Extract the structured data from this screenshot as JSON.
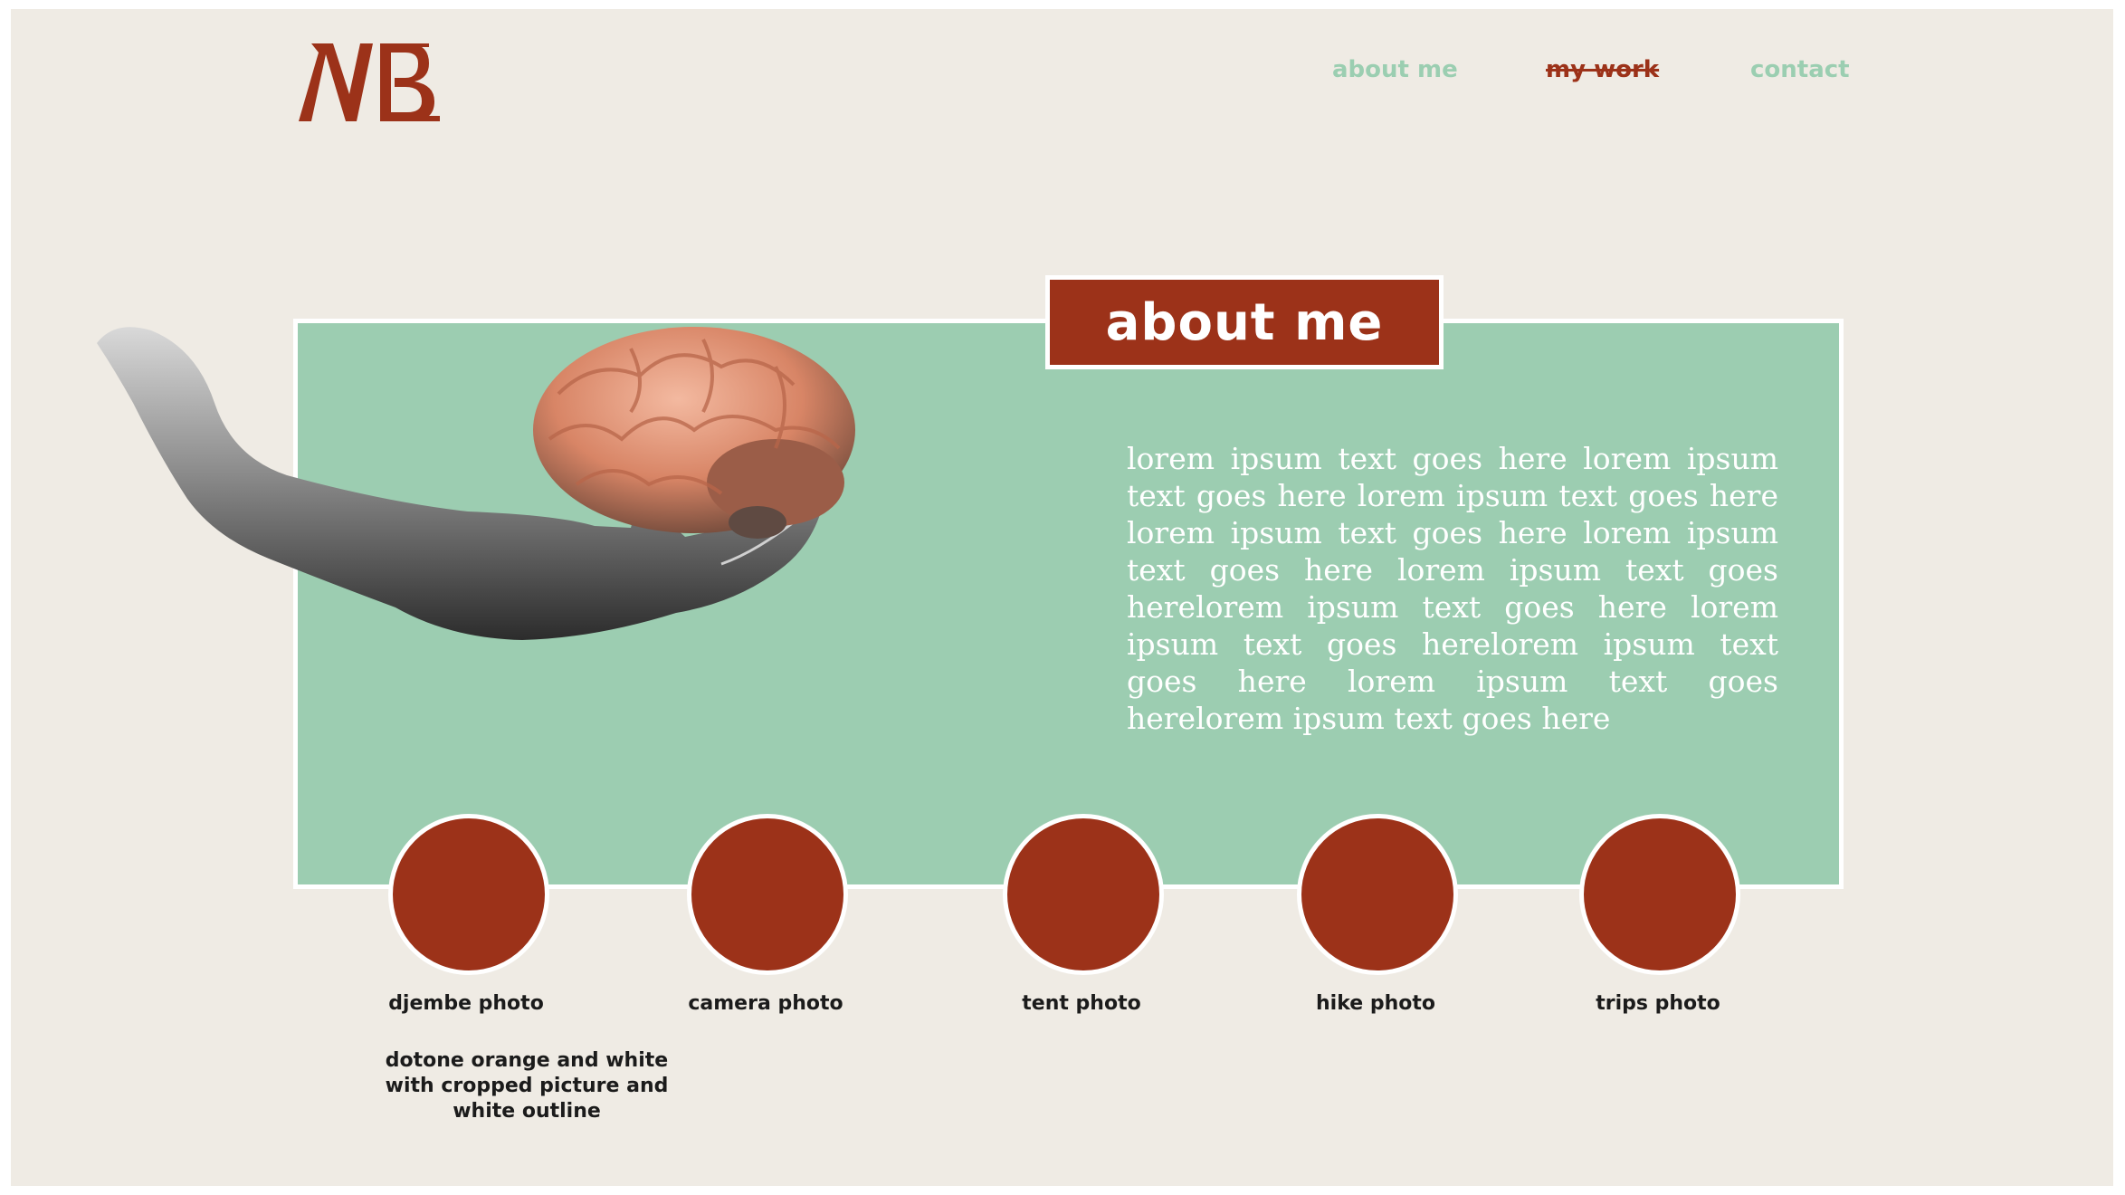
{
  "brand": {
    "logo_text": "MB",
    "accent": "#9c3219",
    "mint": "#9ccdb1",
    "background": "#efebe4"
  },
  "nav": {
    "items": [
      {
        "label": "about me",
        "state": "default"
      },
      {
        "label": "my work",
        "state": "current"
      },
      {
        "label": "contact",
        "state": "default"
      }
    ]
  },
  "about": {
    "title": "about me",
    "body": "lorem ipsum text goes here lorem ipsum text goes here lorem ipsum text goes here lorem ipsum text goes here lorem ipsum text goes here lorem ipsum text goes herelorem ipsum text goes here lorem ipsum text goes herelorem ipsum text goes here lorem ipsum text goes herelorem ipsum text goes here",
    "illustration": "hand-holding-brain-image"
  },
  "photos": [
    {
      "label": "djembe photo"
    },
    {
      "label": "camera photo"
    },
    {
      "label": "tent photo"
    },
    {
      "label": "hike photo"
    },
    {
      "label": "trips photo"
    }
  ],
  "note": "dotone orange and white with cropped picture and white outline"
}
